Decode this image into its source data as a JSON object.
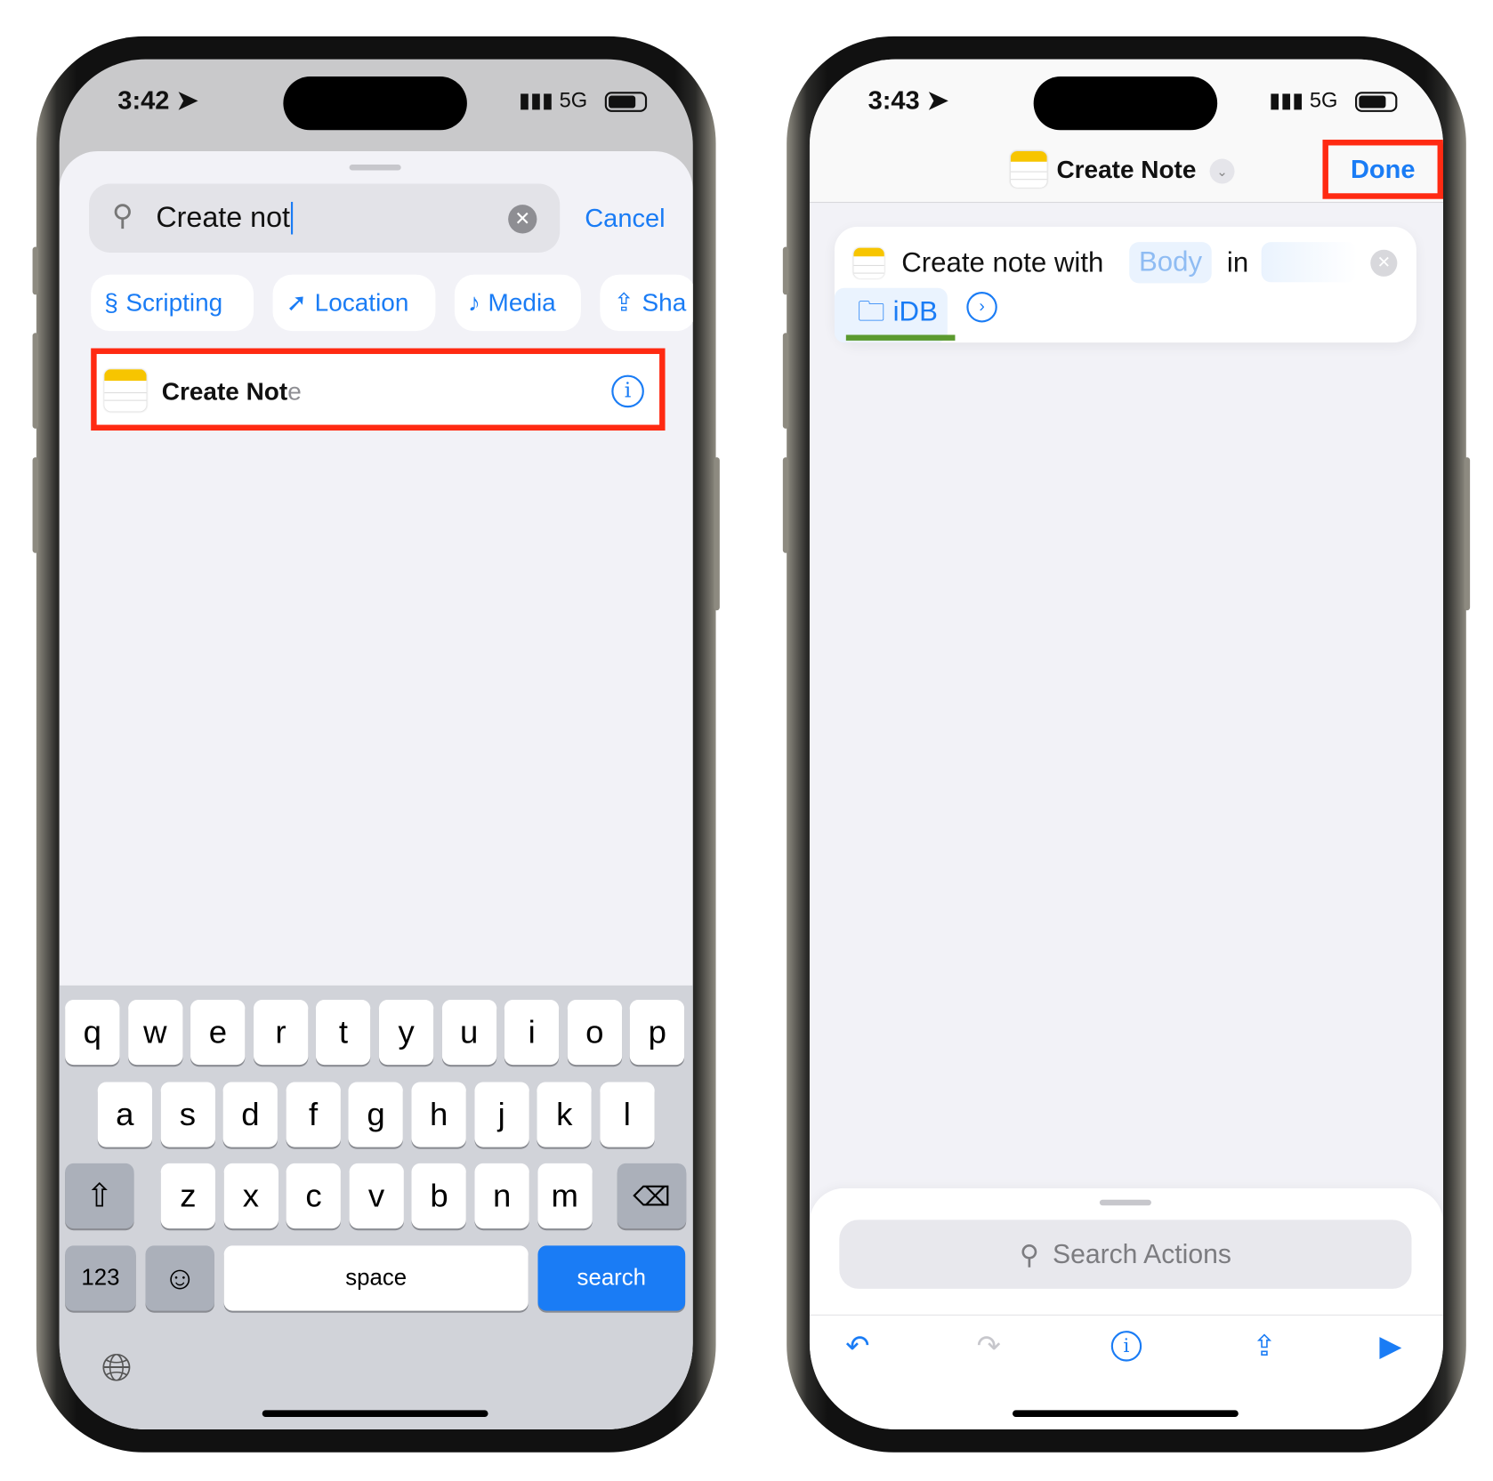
{
  "left_phone": {
    "status": {
      "time": "3:42",
      "network": "5G"
    },
    "search": {
      "value": "Create not",
      "clear_icon": "clear-icon",
      "cancel_label": "Cancel"
    },
    "chips": [
      {
        "label": "Scripting",
        "icon": "scripting-icon"
      },
      {
        "label": "Location",
        "icon": "location-arrow-icon"
      },
      {
        "label": "Media",
        "icon": "music-note-icon"
      },
      {
        "label": "Sha",
        "icon": "share-icon"
      }
    ],
    "result": {
      "title_typed": "Create Not",
      "title_completion": "e",
      "info_icon": "info-icon"
    },
    "keyboard": {
      "row1": [
        "q",
        "w",
        "e",
        "r",
        "t",
        "y",
        "u",
        "i",
        "o",
        "p"
      ],
      "row2": [
        "a",
        "s",
        "d",
        "f",
        "g",
        "h",
        "j",
        "k",
        "l"
      ],
      "row3": [
        "z",
        "x",
        "c",
        "v",
        "b",
        "n",
        "m"
      ],
      "numbers_label": "123",
      "space_label": "space",
      "search_label": "search"
    }
  },
  "right_phone": {
    "status": {
      "time": "3:43",
      "network": "5G"
    },
    "header": {
      "title": "Create Note",
      "done_label": "Done"
    },
    "action": {
      "prefix": "Create note with",
      "body_token": "Body",
      "in_label": "in",
      "folder_token": "iDB"
    },
    "search_actions_placeholder": "Search Actions"
  },
  "colors": {
    "accent": "#1a7cf5",
    "highlight": "#ff2a12",
    "underline": "#5b9a2e"
  }
}
